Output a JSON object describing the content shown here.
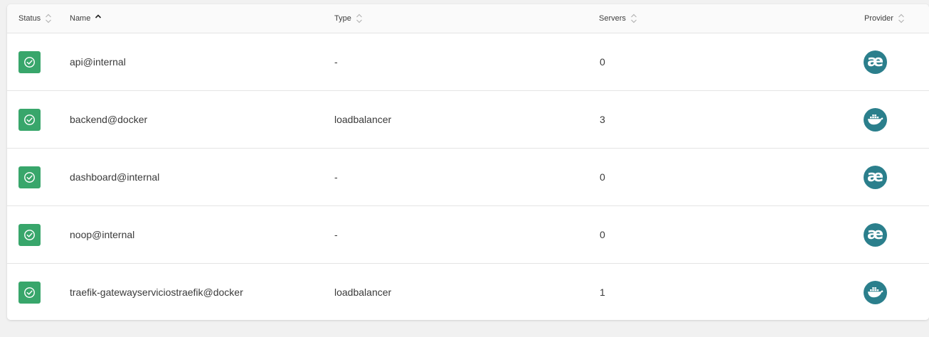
{
  "header": {
    "status": "Status",
    "name": "Name",
    "type": "Type",
    "servers": "Servers",
    "provider": "Provider"
  },
  "sort": {
    "column": "name",
    "direction": "asc"
  },
  "colors": {
    "status_ok": "#38a66b",
    "provider": "#2b7f8c",
    "background": "#f1f1f1"
  },
  "rows": [
    {
      "status": "enabled",
      "name": "api@internal",
      "type": "-",
      "servers": "0",
      "provider": "internal",
      "provider_icon": "ae",
      "provider_icon_name": "internal-provider-icon"
    },
    {
      "status": "enabled",
      "name": "backend@docker",
      "type": "loadbalancer",
      "servers": "3",
      "provider": "docker",
      "provider_icon": "docker",
      "provider_icon_name": "docker-provider-icon"
    },
    {
      "status": "enabled",
      "name": "dashboard@internal",
      "type": "-",
      "servers": "0",
      "provider": "internal",
      "provider_icon": "ae",
      "provider_icon_name": "internal-provider-icon"
    },
    {
      "status": "enabled",
      "name": "noop@internal",
      "type": "-",
      "servers": "0",
      "provider": "internal",
      "provider_icon": "ae",
      "provider_icon_name": "internal-provider-icon"
    },
    {
      "status": "enabled",
      "name": "traefik-gatewayserviciostraefik@docker",
      "type": "loadbalancer",
      "servers": "1",
      "provider": "docker",
      "provider_icon": "docker",
      "provider_icon_name": "docker-provider-icon"
    }
  ]
}
